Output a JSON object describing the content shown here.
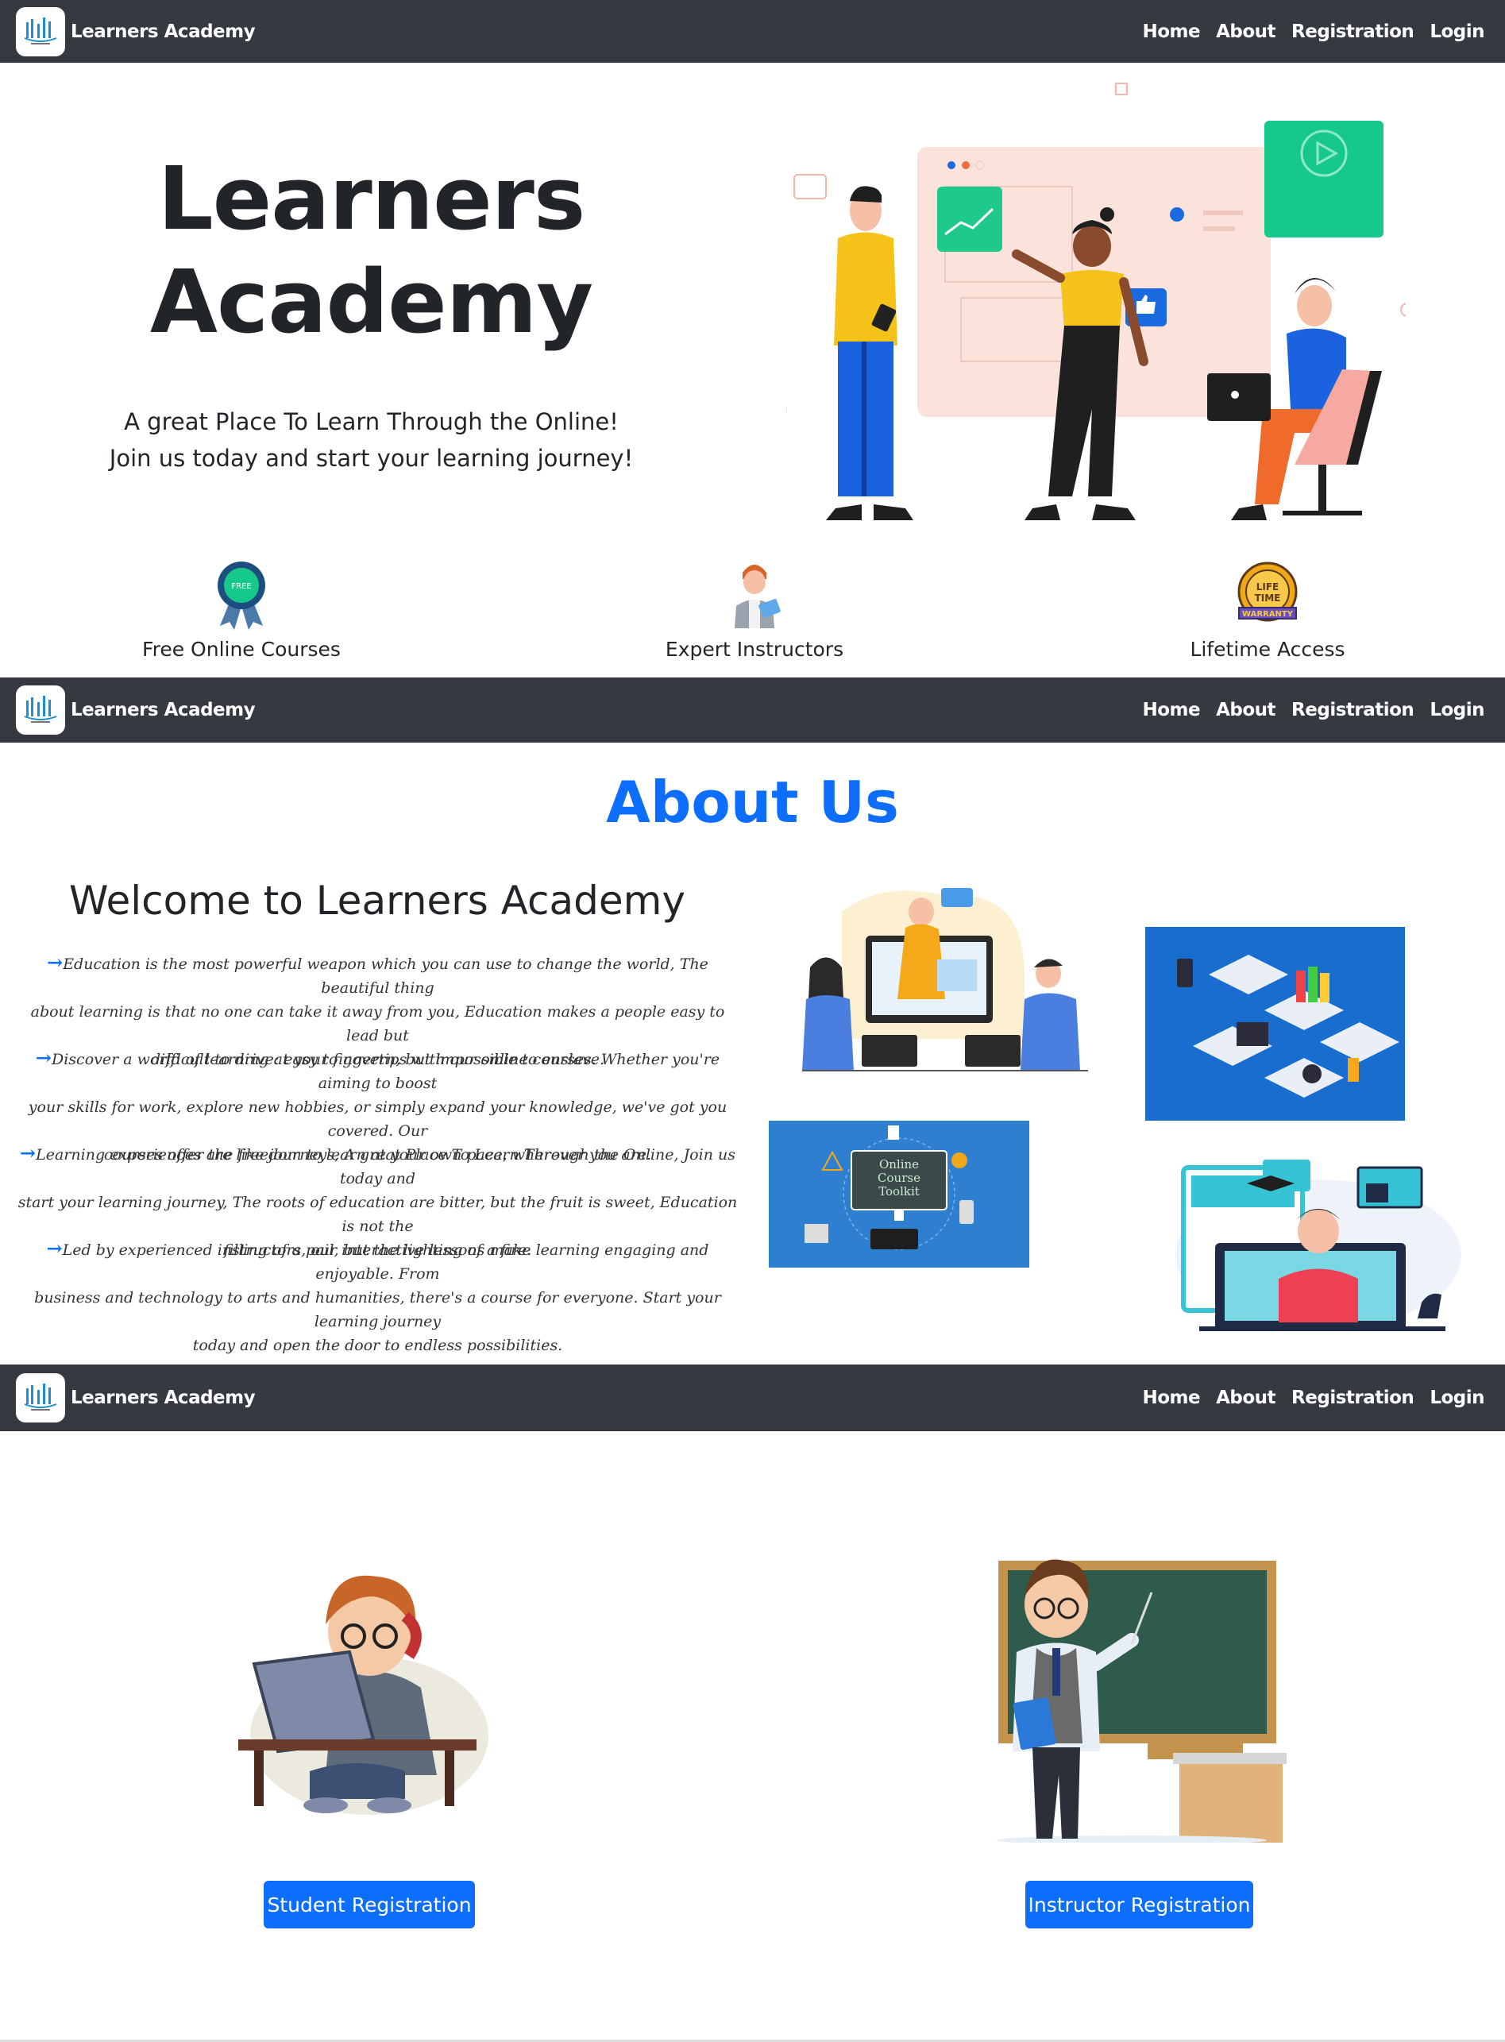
{
  "brand": {
    "name": "Learners Academy",
    "logo_icon": "books-logo-icon"
  },
  "nav": {
    "home": "Home",
    "about": "About",
    "registration": "Registration",
    "login": "Login"
  },
  "hero": {
    "title_line1": "Learners",
    "title_line2": "Academy",
    "subtitle_line1": "A great Place To Learn Through the Online!",
    "subtitle_line2": "Join us today and start your learning journey!"
  },
  "features": [
    {
      "label": "Free Online Courses",
      "icon": "free-badge-icon"
    },
    {
      "label": "Expert Instructors",
      "icon": "instructor-icon"
    },
    {
      "label": "Lifetime Access",
      "icon": "lifetime-warranty-icon"
    }
  ],
  "about": {
    "heading": "About Us",
    "welcome": "Welcome to Learners Academy",
    "paragraphs": [
      {
        "line1": "Education is the most powerful weapon which you can use to change the world, The beautiful thing",
        "line2": "about learning is that no one can take it away from you, Education makes a people easy to lead but",
        "line3": "difficult to drive: easy to govern, but impossible to enslave."
      },
      {
        "line1": "Discover a world of learning at your fingertips with our online courses. Whether you're aiming to boost",
        "line2": "your skills for work, explore new hobbies, or simply expand your knowledge, we've got you covered. Our",
        "line3": "courses offer the freedom to learn at your own pace, wherever you are."
      },
      {
        "line1": "Learning experiences are like journeys, A great Place To Learn Through the Online, Join us today and",
        "line2": "start your learning journey, The roots of education are bitter, but the fruit is sweet, Education is not the",
        "line3": "filling of a pail, but the lighting of a fire."
      },
      {
        "line1": "Led by experienced instructors, our interactive lessons make learning engaging and enjoyable. From",
        "line2": "business and technology to arts and humanities, there's a course for everyone. Start your learning journey",
        "line3": "today and open the door to endless possibilities."
      }
    ],
    "toolkit_text": [
      "Online",
      "Course",
      "Toolkit"
    ]
  },
  "registration": {
    "student_button": "Student Registration",
    "instructor_button": "Instructor Registration"
  },
  "colors": {
    "navbar": "#343a40",
    "accent": "#0d6efd"
  }
}
